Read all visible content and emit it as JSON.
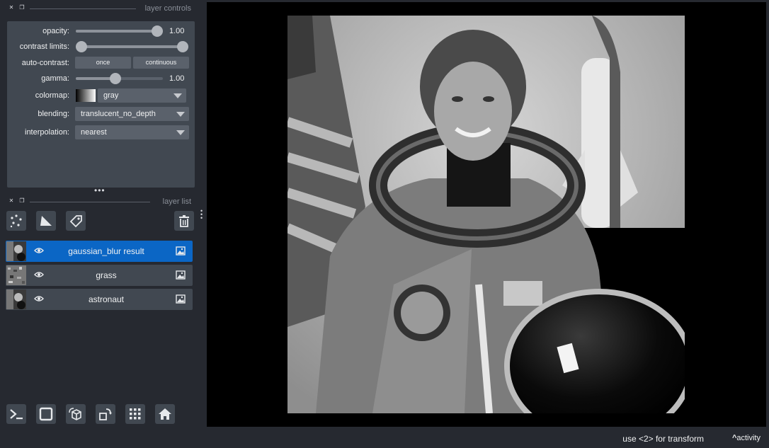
{
  "layer_controls": {
    "title": "layer controls",
    "opacity": {
      "label": "opacity:",
      "value": 1.0,
      "value_text": "1.00"
    },
    "contrast_limits": {
      "label": "contrast limits:",
      "min_fraction": 0.0,
      "max_fraction": 1.0
    },
    "auto_contrast": {
      "label": "auto-contrast:",
      "once_label": "once",
      "continuous_label": "continuous"
    },
    "gamma": {
      "label": "gamma:",
      "value": 1.0,
      "value_text": "1.00",
      "fraction": 0.45
    },
    "colormap": {
      "label": "colormap:",
      "value": "gray"
    },
    "blending": {
      "label": "blending:",
      "value": "translucent_no_depth"
    },
    "interpolation": {
      "label": "interpolation:",
      "value": "nearest"
    }
  },
  "layer_list": {
    "title": "layer list",
    "buttons": [
      "points-icon",
      "shapes-icon",
      "labels-icon",
      "delete-icon"
    ],
    "layers": [
      {
        "name": "gaussian_blur result",
        "selected": true,
        "visible": true
      },
      {
        "name": "grass",
        "selected": false,
        "visible": true
      },
      {
        "name": "astronaut",
        "selected": false,
        "visible": true
      }
    ]
  },
  "bottom_tools": [
    "console-icon",
    "ndisplay-icon",
    "roll-icon",
    "transpose-icon",
    "grid-icon",
    "home-icon"
  ],
  "status": {
    "text": "use <2> for transform",
    "activity_label": "activity"
  },
  "colors": {
    "selected_layer": "#0b66c5",
    "background": "#262930",
    "panel": "#414851"
  }
}
